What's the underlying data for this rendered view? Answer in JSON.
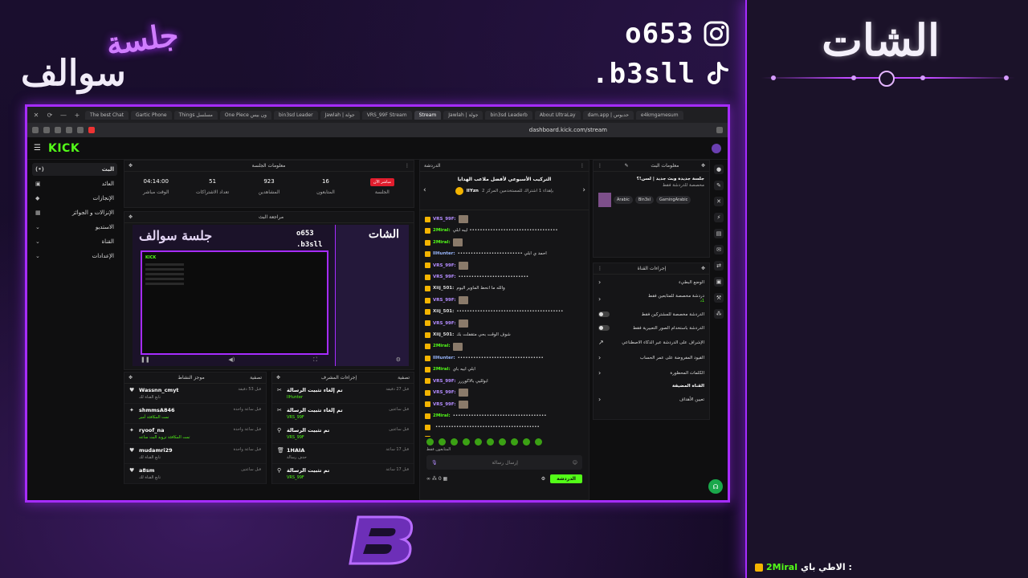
{
  "overlay": {
    "chat_title": "الشات",
    "logo_line1": "جلسة",
    "logo_line2": "سوالف",
    "instagram": "o653",
    "tiktok": "b3sll",
    "bottom_message": {
      "text": "الاطي باي :",
      "user": "2Miral"
    }
  },
  "browser": {
    "tabs": [
      "The best Chat",
      "Gartic Phone",
      "Things مسلسل",
      "One Piece ون بيس",
      "bin3sd Leader",
      "Jawlah | جولة",
      "VRS_99F Stream",
      "Stream",
      "Jawlah | جولة",
      "bin3sd Leaderb",
      "About UltraLay",
      "dam.app | حدبوس",
      "e4kmgamesum"
    ],
    "active_tab": "Stream",
    "url": "dashboard.kick.com/stream"
  },
  "kick": {
    "logo": "KICK",
    "sidebar": [
      {
        "label": "البث",
        "icon": "(•)",
        "active": true
      },
      {
        "label": "العائد",
        "icon": "▣"
      },
      {
        "label": "الإنجازات",
        "icon": "◆"
      },
      {
        "label": "الإنزالات و الجوائز",
        "icon": "▦"
      },
      {
        "label": "الاستديو",
        "icon": "⌄"
      },
      {
        "label": "القناة",
        "icon": "⌄"
      },
      {
        "label": "الإعدادات",
        "icon": "⌄"
      }
    ],
    "session": {
      "title": "معلومات الجلسة",
      "live_badge": "مباشر الآن",
      "stats": [
        {
          "value": "",
          "label": "الجلسة"
        },
        {
          "value": "16",
          "label": "المتابعون"
        },
        {
          "value": "923",
          "label": "المشاهدين"
        },
        {
          "value": "51",
          "label": "تعداد الاشتراكات"
        },
        {
          "value": "04:14:00",
          "label": "الوقت مباشر"
        }
      ]
    },
    "preview_title": "مراجعة البث",
    "preview": {
      "mini_chat": "الشات",
      "mini_logo": "جلسة سوالف",
      "mini_ig": "o653",
      "mini_tt": ".b3sll",
      "mini_kick": "KICK"
    },
    "activity": {
      "title": "موجز النشاط",
      "filter": "تصفية",
      "rows": [
        {
          "name": "Wassnn_cmyt",
          "sub": "تابع القناة لك",
          "time": "قبل 53 دقيقة",
          "icon": "♥"
        },
        {
          "name": "shmmsA846",
          "sub": "تمت المكافئة أمير",
          "time": "قبل ساعة واحدة",
          "icon": "✦"
        },
        {
          "name": "ryoof_na",
          "sub": "تمت المكافئة تزويد البث ساعه",
          "time": "قبل ساعة واحدة",
          "icon": "✦"
        },
        {
          "name": "mudamri29",
          "sub": "تابع القناة لك",
          "time": "قبل ساعة واحدة",
          "icon": "♥"
        },
        {
          "name": "a8sm",
          "sub": "تابع القناة لك",
          "time": "قبل ساعتين",
          "icon": "♥"
        }
      ]
    },
    "mod": {
      "title": "إجراءات المشرف",
      "filter": "تصفية",
      "rows": [
        {
          "name": "تم إلغاء تثبيت الرسالة",
          "sub": "IlHunter",
          "time": "قبل 27 دقيقة"
        },
        {
          "name": "تم إلغاء تثبيت الرسالة",
          "sub": "VRS_99F",
          "time": "قبل ساعتين"
        },
        {
          "name": "تم تثبيت الرسالة",
          "sub": "VRS_99F",
          "time": "قبل ساعتين"
        },
        {
          "name": "1HAIA",
          "sub": "حذف رسالة",
          "time": "قبل 17 ساعة"
        },
        {
          "name": "تم تثبيت الرسالة",
          "sub": "VRS_99F",
          "time": "قبل 17 ساعة"
        }
      ]
    },
    "chat": {
      "title": "الدردشة",
      "pinned_text": "التركيب الأسبوعي لأفضل ملاعب الهدايا",
      "pinned_user": "IIYzn",
      "pinned_sub": "بإهداء 1 اشتراك للمستخدمين المركز 2",
      "lines": [
        {
          "user": "VRS_99F:",
          "cls": "u1",
          "text": "",
          "thumb": true
        },
        {
          "user": "2Miral:",
          "cls": "u2",
          "text": "ايبه ابلي ••••••••••••••••••••••••••••••••••"
        },
        {
          "user": "2Miral:",
          "cls": "u2",
          "text": "",
          "thumb": true
        },
        {
          "user": "IlHunter:",
          "cls": "u3",
          "text": "••••••••••••••••••••••••• احمد ي ابلي"
        },
        {
          "user": "VRS_99F:",
          "cls": "u1",
          "text": "",
          "thumb": true
        },
        {
          "user": "VRS_99F:",
          "cls": "u1",
          "text": "•••••••••••••••••••••••••••"
        },
        {
          "user": "Xiij_501:",
          "cls": "u4",
          "text": "والله ما انحط الماوير اليوم"
        },
        {
          "user": "VRS_99F:",
          "cls": "u1",
          "text": "",
          "thumb": true
        },
        {
          "user": "Xiij_501:",
          "cls": "u4",
          "text": "•••••••••••••••••••••••••••••••••••••••••"
        },
        {
          "user": "VRS_99F:",
          "cls": "u1",
          "text": "",
          "thumb": true
        },
        {
          "user": "Xiij_501:",
          "cls": "u4",
          "text": "شوف الوقت بحي متقفلت بك"
        },
        {
          "user": "2Miral:",
          "cls": "u2",
          "text": "",
          "thumb": true
        },
        {
          "user": "IlHunter:",
          "cls": "u3",
          "text": "•••••••••••••••••••••••••••••••••"
        },
        {
          "user": "2Miral:",
          "cls": "u2",
          "text": "ابلي ابيه باي"
        },
        {
          "user": "VRS_99F:",
          "cls": "u1",
          "text": "ابولليي بالاكوررر"
        },
        {
          "user": "VRS_99F:",
          "cls": "u1",
          "text": "",
          "thumb": true
        },
        {
          "user": "VRS_99F:",
          "cls": "u1",
          "text": "",
          "thumb": true
        },
        {
          "user": "2Miral:",
          "cls": "u2",
          "text": "••••••••••••••••••••••••••••••••••••"
        },
        {
          "user": "",
          "cls": "u4",
          "text": "••••••••••••••••••••••••••••••••••••••••"
        },
        {
          "user": "2Miral:",
          "cls": "u2",
          "text": "الاطي باي"
        }
      ],
      "followers_only": "المتابعون فقط",
      "placeholder": "إرسال رسالة",
      "viewer_count": "0",
      "send": "الدردشة"
    },
    "stream_info": {
      "title": "معلومات البث",
      "stream_title": "جلسة جديدة وبث جديد | لسن!؟",
      "category": "مخصصة للدردشة فقط",
      "tags": [
        "Arabic",
        "Bin3sl",
        "GamingArabic"
      ]
    },
    "channel_actions": {
      "title": "إجراءات القناة",
      "rows": [
        {
          "label": "الوضع البطيء",
          "type": "chev"
        },
        {
          "label": "دردشة مخصصة للمتابعين فقط",
          "sub": "1د",
          "type": "chev"
        },
        {
          "label": "الدردشة مخصصة للمشتركين فقط",
          "type": "toggle"
        },
        {
          "label": "الدردشة باستخدام الصور التعبيرية فقط",
          "type": "toggle"
        },
        {
          "label": "الإشراف على الدردشة عبر الذكاء الاصطناعي",
          "type": "ext"
        },
        {
          "label": "القيود المفروضة على عمر الحساب",
          "type": "chev"
        },
        {
          "label": "الكلمات المحظورة",
          "type": "chev"
        }
      ],
      "section": "القناة المضيفة",
      "host_row": "تعيين الأهداف"
    }
  }
}
